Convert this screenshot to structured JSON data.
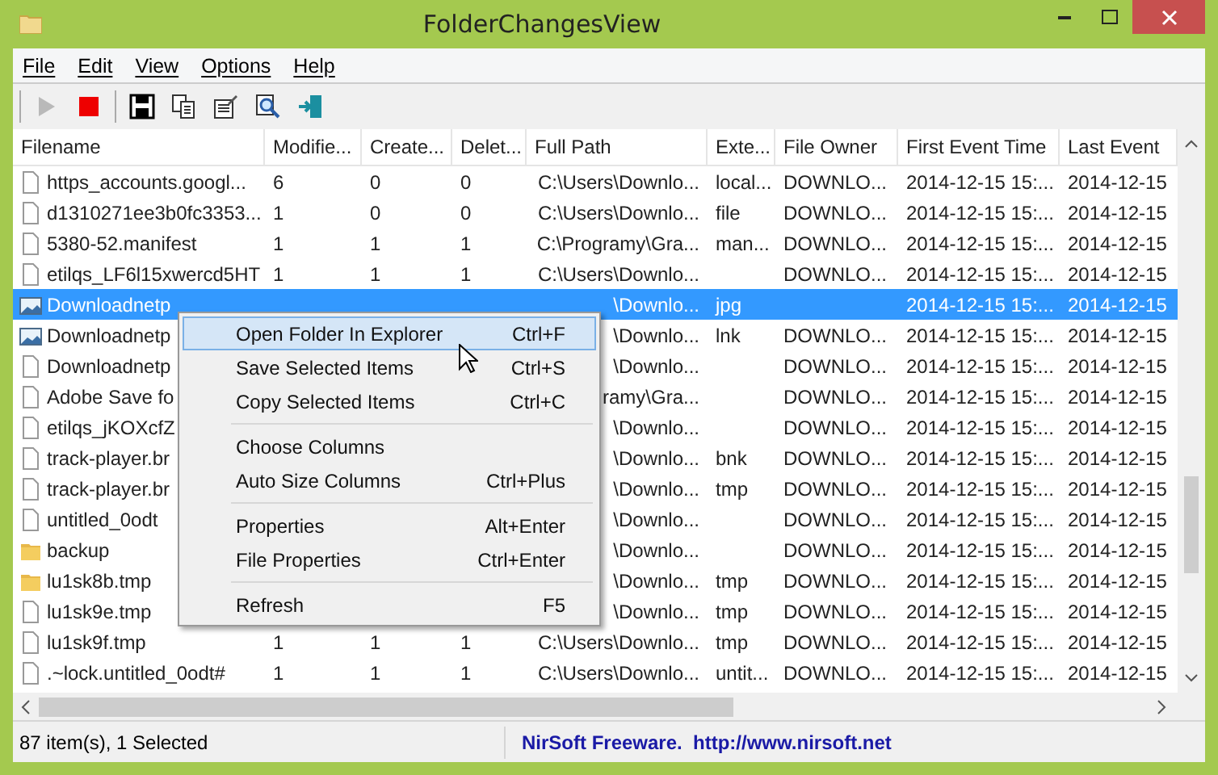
{
  "window": {
    "title": "FolderChangesView"
  },
  "menu": [
    "File",
    "Edit",
    "View",
    "Options",
    "Help"
  ],
  "toolbar": [
    {
      "kind": "play",
      "disabled": true
    },
    {
      "kind": "stop",
      "disabled": false
    },
    {
      "kind": "separator"
    },
    {
      "kind": "save",
      "disabled": false
    },
    {
      "kind": "copy",
      "disabled": false
    },
    {
      "kind": "properties",
      "disabled": false
    },
    {
      "kind": "find",
      "disabled": false
    },
    {
      "kind": "exit",
      "disabled": false
    }
  ],
  "table": {
    "columns": [
      "Filename",
      "Modifie...",
      "Create...",
      "Delet...",
      "Full Path",
      "Exte...",
      "File Owner",
      "First Event Time",
      "Last Event"
    ],
    "rows": [
      {
        "kind": "file",
        "selected": false,
        "cells": [
          "https_accounts.googl...",
          "6",
          "0",
          "0",
          "C:\\Users\\Downlo...",
          "local...",
          "DOWNLO...",
          "2014-12-15 15:...",
          "2014-12-15"
        ]
      },
      {
        "kind": "file",
        "selected": false,
        "cells": [
          "d1310271ee3b0fc3353...",
          "1",
          "0",
          "0",
          "C:\\Users\\Downlo...",
          "file",
          "DOWNLO...",
          "2014-12-15 15:...",
          "2014-12-15"
        ]
      },
      {
        "kind": "file",
        "selected": false,
        "cells": [
          "5380-52.manifest",
          "1",
          "1",
          "1",
          "C:\\Programy\\Gra...",
          "man...",
          "DOWNLO...",
          "2014-12-15 15:...",
          "2014-12-15"
        ]
      },
      {
        "kind": "file",
        "selected": false,
        "cells": [
          "etilqs_LF6l15xwercd5HT",
          "1",
          "1",
          "1",
          "C:\\Users\\Downlo...",
          null,
          "DOWNLO...",
          "2014-12-15 15:...",
          "2014-12-15"
        ]
      },
      {
        "kind": "image",
        "selected": true,
        "cells": [
          "Downloadnetp",
          null,
          null,
          null,
          "\\Downlo...",
          "jpg",
          null,
          "2014-12-15 15:...",
          "2014-12-15"
        ]
      },
      {
        "kind": "image",
        "selected": false,
        "cells": [
          "Downloadnetp",
          null,
          null,
          null,
          "\\Downlo...",
          "lnk",
          "DOWNLO...",
          "2014-12-15 15:...",
          "2014-12-15"
        ]
      },
      {
        "kind": "file",
        "selected": false,
        "cells": [
          "Downloadnetp",
          null,
          null,
          null,
          "\\Downlo...",
          null,
          "DOWNLO...",
          "2014-12-15 15:...",
          "2014-12-15"
        ]
      },
      {
        "kind": "file",
        "selected": false,
        "cells": [
          "Adobe Save fo",
          null,
          null,
          null,
          "ramy\\Gra...",
          null,
          "DOWNLO...",
          "2014-12-15 15:...",
          "2014-12-15"
        ]
      },
      {
        "kind": "file",
        "selected": false,
        "cells": [
          "etilqs_jKOXcfZ",
          null,
          null,
          null,
          "\\Downlo...",
          null,
          "DOWNLO...",
          "2014-12-15 15:...",
          "2014-12-15"
        ]
      },
      {
        "kind": "file",
        "selected": false,
        "cells": [
          "track-player.br",
          null,
          null,
          null,
          "\\Downlo...",
          "bnk",
          "DOWNLO...",
          "2014-12-15 15:...",
          "2014-12-15"
        ]
      },
      {
        "kind": "file",
        "selected": false,
        "cells": [
          "track-player.br",
          null,
          null,
          null,
          "\\Downlo...",
          "tmp",
          "DOWNLO...",
          "2014-12-15 15:...",
          "2014-12-15"
        ]
      },
      {
        "kind": "file",
        "selected": false,
        "cells": [
          "untitled_0odt",
          null,
          null,
          null,
          "\\Downlo...",
          null,
          "DOWNLO...",
          "2014-12-15 15:...",
          "2014-12-15"
        ]
      },
      {
        "kind": "folder",
        "selected": false,
        "cells": [
          "backup",
          null,
          null,
          null,
          "\\Downlo...",
          null,
          "DOWNLO...",
          "2014-12-15 15:...",
          "2014-12-15"
        ]
      },
      {
        "kind": "folder",
        "selected": false,
        "cells": [
          "lu1sk8b.tmp",
          null,
          null,
          null,
          "\\Downlo...",
          "tmp",
          "DOWNLO...",
          "2014-12-15 15:...",
          "2014-12-15"
        ]
      },
      {
        "kind": "file",
        "selected": false,
        "cells": [
          "lu1sk9e.tmp",
          null,
          null,
          null,
          "\\Downlo...",
          "tmp",
          "DOWNLO...",
          "2014-12-15 15:...",
          "2014-12-15"
        ]
      },
      {
        "kind": "file",
        "selected": false,
        "cells": [
          "lu1sk9f.tmp",
          "1",
          "1",
          "1",
          "C:\\Users\\Downlo...",
          "tmp",
          "DOWNLO...",
          "2014-12-15 15:...",
          "2014-12-15"
        ]
      },
      {
        "kind": "file",
        "selected": false,
        "cells": [
          ".~lock.untitled_0odt#",
          "1",
          "1",
          "1",
          "C:\\Users\\Downlo...",
          "untit...",
          "DOWNLO...",
          "2014-12-15 15:...",
          "2014-12-15"
        ]
      }
    ]
  },
  "context_menu": [
    {
      "kind": "item",
      "label": "Open Folder In Explorer",
      "shortcut": "Ctrl+F",
      "selected": true
    },
    {
      "kind": "item",
      "label": "Save Selected Items",
      "shortcut": "Ctrl+S",
      "selected": false
    },
    {
      "kind": "item",
      "label": "Copy Selected Items",
      "shortcut": "Ctrl+C",
      "selected": false
    },
    {
      "kind": "separator"
    },
    {
      "kind": "item",
      "label": "Choose Columns",
      "selected": false
    },
    {
      "kind": "item",
      "label": "Auto Size Columns",
      "shortcut": "Ctrl+Plus",
      "selected": false
    },
    {
      "kind": "separator"
    },
    {
      "kind": "item",
      "label": "Properties",
      "shortcut": "Alt+Enter",
      "selected": false
    },
    {
      "kind": "item",
      "label": "File Properties",
      "shortcut": "Ctrl+Enter",
      "selected": false
    },
    {
      "kind": "separator"
    },
    {
      "kind": "item",
      "label": "Refresh",
      "shortcut": "F5",
      "selected": false
    }
  ],
  "status_bar": {
    "count": "87 item(s), 1 Selected",
    "credit": "NirSoft Freeware.  http://www.nirsoft.net"
  }
}
